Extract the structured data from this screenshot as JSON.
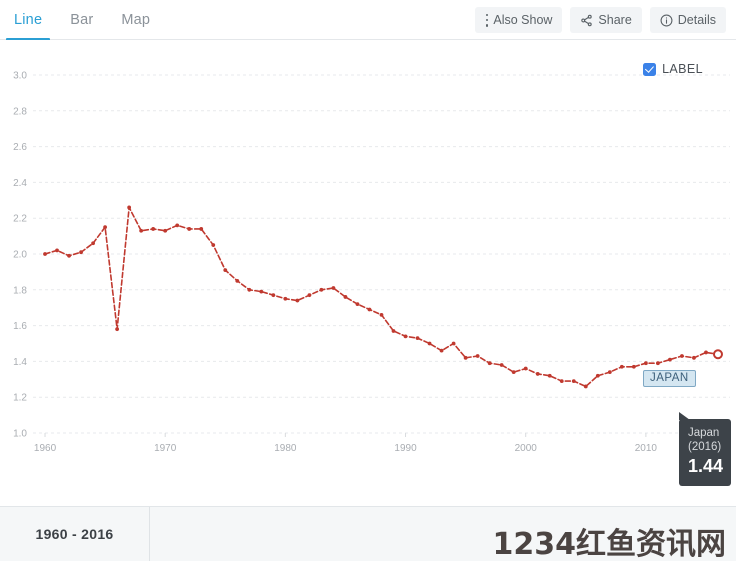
{
  "toolbar": {
    "tabs": [
      {
        "label": "Line",
        "active": true
      },
      {
        "label": "Bar",
        "active": false
      },
      {
        "label": "Map",
        "active": false
      }
    ],
    "buttons": [
      {
        "label": "Also Show",
        "icon": "more-vertical-icon"
      },
      {
        "label": "Share",
        "icon": "share-icon"
      },
      {
        "label": "Details",
        "icon": "info-circle-icon"
      }
    ]
  },
  "legend": {
    "label_checkbox": {
      "label": "LABEL",
      "checked": true
    }
  },
  "series_badge": {
    "text": "JAPAN"
  },
  "tooltip": {
    "name": "Japan",
    "year": "(2016)",
    "value": "1.44"
  },
  "footer": {
    "range": "1960 - 2016",
    "watermark": "1234红鱼资讯网"
  },
  "colors": {
    "accent": "#2b9fd4",
    "line": "#c0392f",
    "tooltip_bg": "#3d4349",
    "badge_bg": "#d4e6f1",
    "badge_border": "#7fa8c4",
    "checkbox": "#3b82e8",
    "grid": "#e7e9ec",
    "axis_text": "#a9adb2"
  },
  "chart_data": {
    "type": "line",
    "title": "",
    "xlabel": "",
    "ylabel": "",
    "xlim": [
      1959,
      2017
    ],
    "ylim": [
      1.0,
      3.0
    ],
    "ytick_step": 0.2,
    "yticks": [
      1.0,
      1.2,
      1.4,
      1.6,
      1.8,
      2.0,
      2.2,
      2.4,
      2.6,
      2.8,
      3.0
    ],
    "xticks": [
      1960,
      1970,
      1980,
      1990,
      2000,
      2010
    ],
    "grid": true,
    "legend_position": "none",
    "series": [
      {
        "name": "Japan",
        "color": "#c0392f",
        "x": [
          1960,
          1961,
          1962,
          1963,
          1964,
          1965,
          1966,
          1967,
          1968,
          1969,
          1970,
          1971,
          1972,
          1973,
          1974,
          1975,
          1976,
          1977,
          1978,
          1979,
          1980,
          1981,
          1982,
          1983,
          1984,
          1985,
          1986,
          1987,
          1988,
          1989,
          1990,
          1991,
          1992,
          1993,
          1994,
          1995,
          1996,
          1997,
          1998,
          1999,
          2000,
          2001,
          2002,
          2003,
          2004,
          2005,
          2006,
          2007,
          2008,
          2009,
          2010,
          2011,
          2012,
          2013,
          2014,
          2015,
          2016
        ],
        "values": [
          2.0,
          2.02,
          1.99,
          2.01,
          2.06,
          2.15,
          1.58,
          2.26,
          2.13,
          2.14,
          2.13,
          2.16,
          2.14,
          2.14,
          2.05,
          1.91,
          1.85,
          1.8,
          1.79,
          1.77,
          1.75,
          1.74,
          1.77,
          1.8,
          1.81,
          1.76,
          1.72,
          1.69,
          1.66,
          1.57,
          1.54,
          1.53,
          1.5,
          1.46,
          1.5,
          1.42,
          1.43,
          1.39,
          1.38,
          1.34,
          1.36,
          1.33,
          1.32,
          1.29,
          1.29,
          1.26,
          1.32,
          1.34,
          1.37,
          1.37,
          1.39,
          1.39,
          1.41,
          1.43,
          1.42,
          1.45,
          1.44
        ],
        "highlight_point": {
          "x": 2016,
          "y": 1.44
        }
      }
    ]
  }
}
